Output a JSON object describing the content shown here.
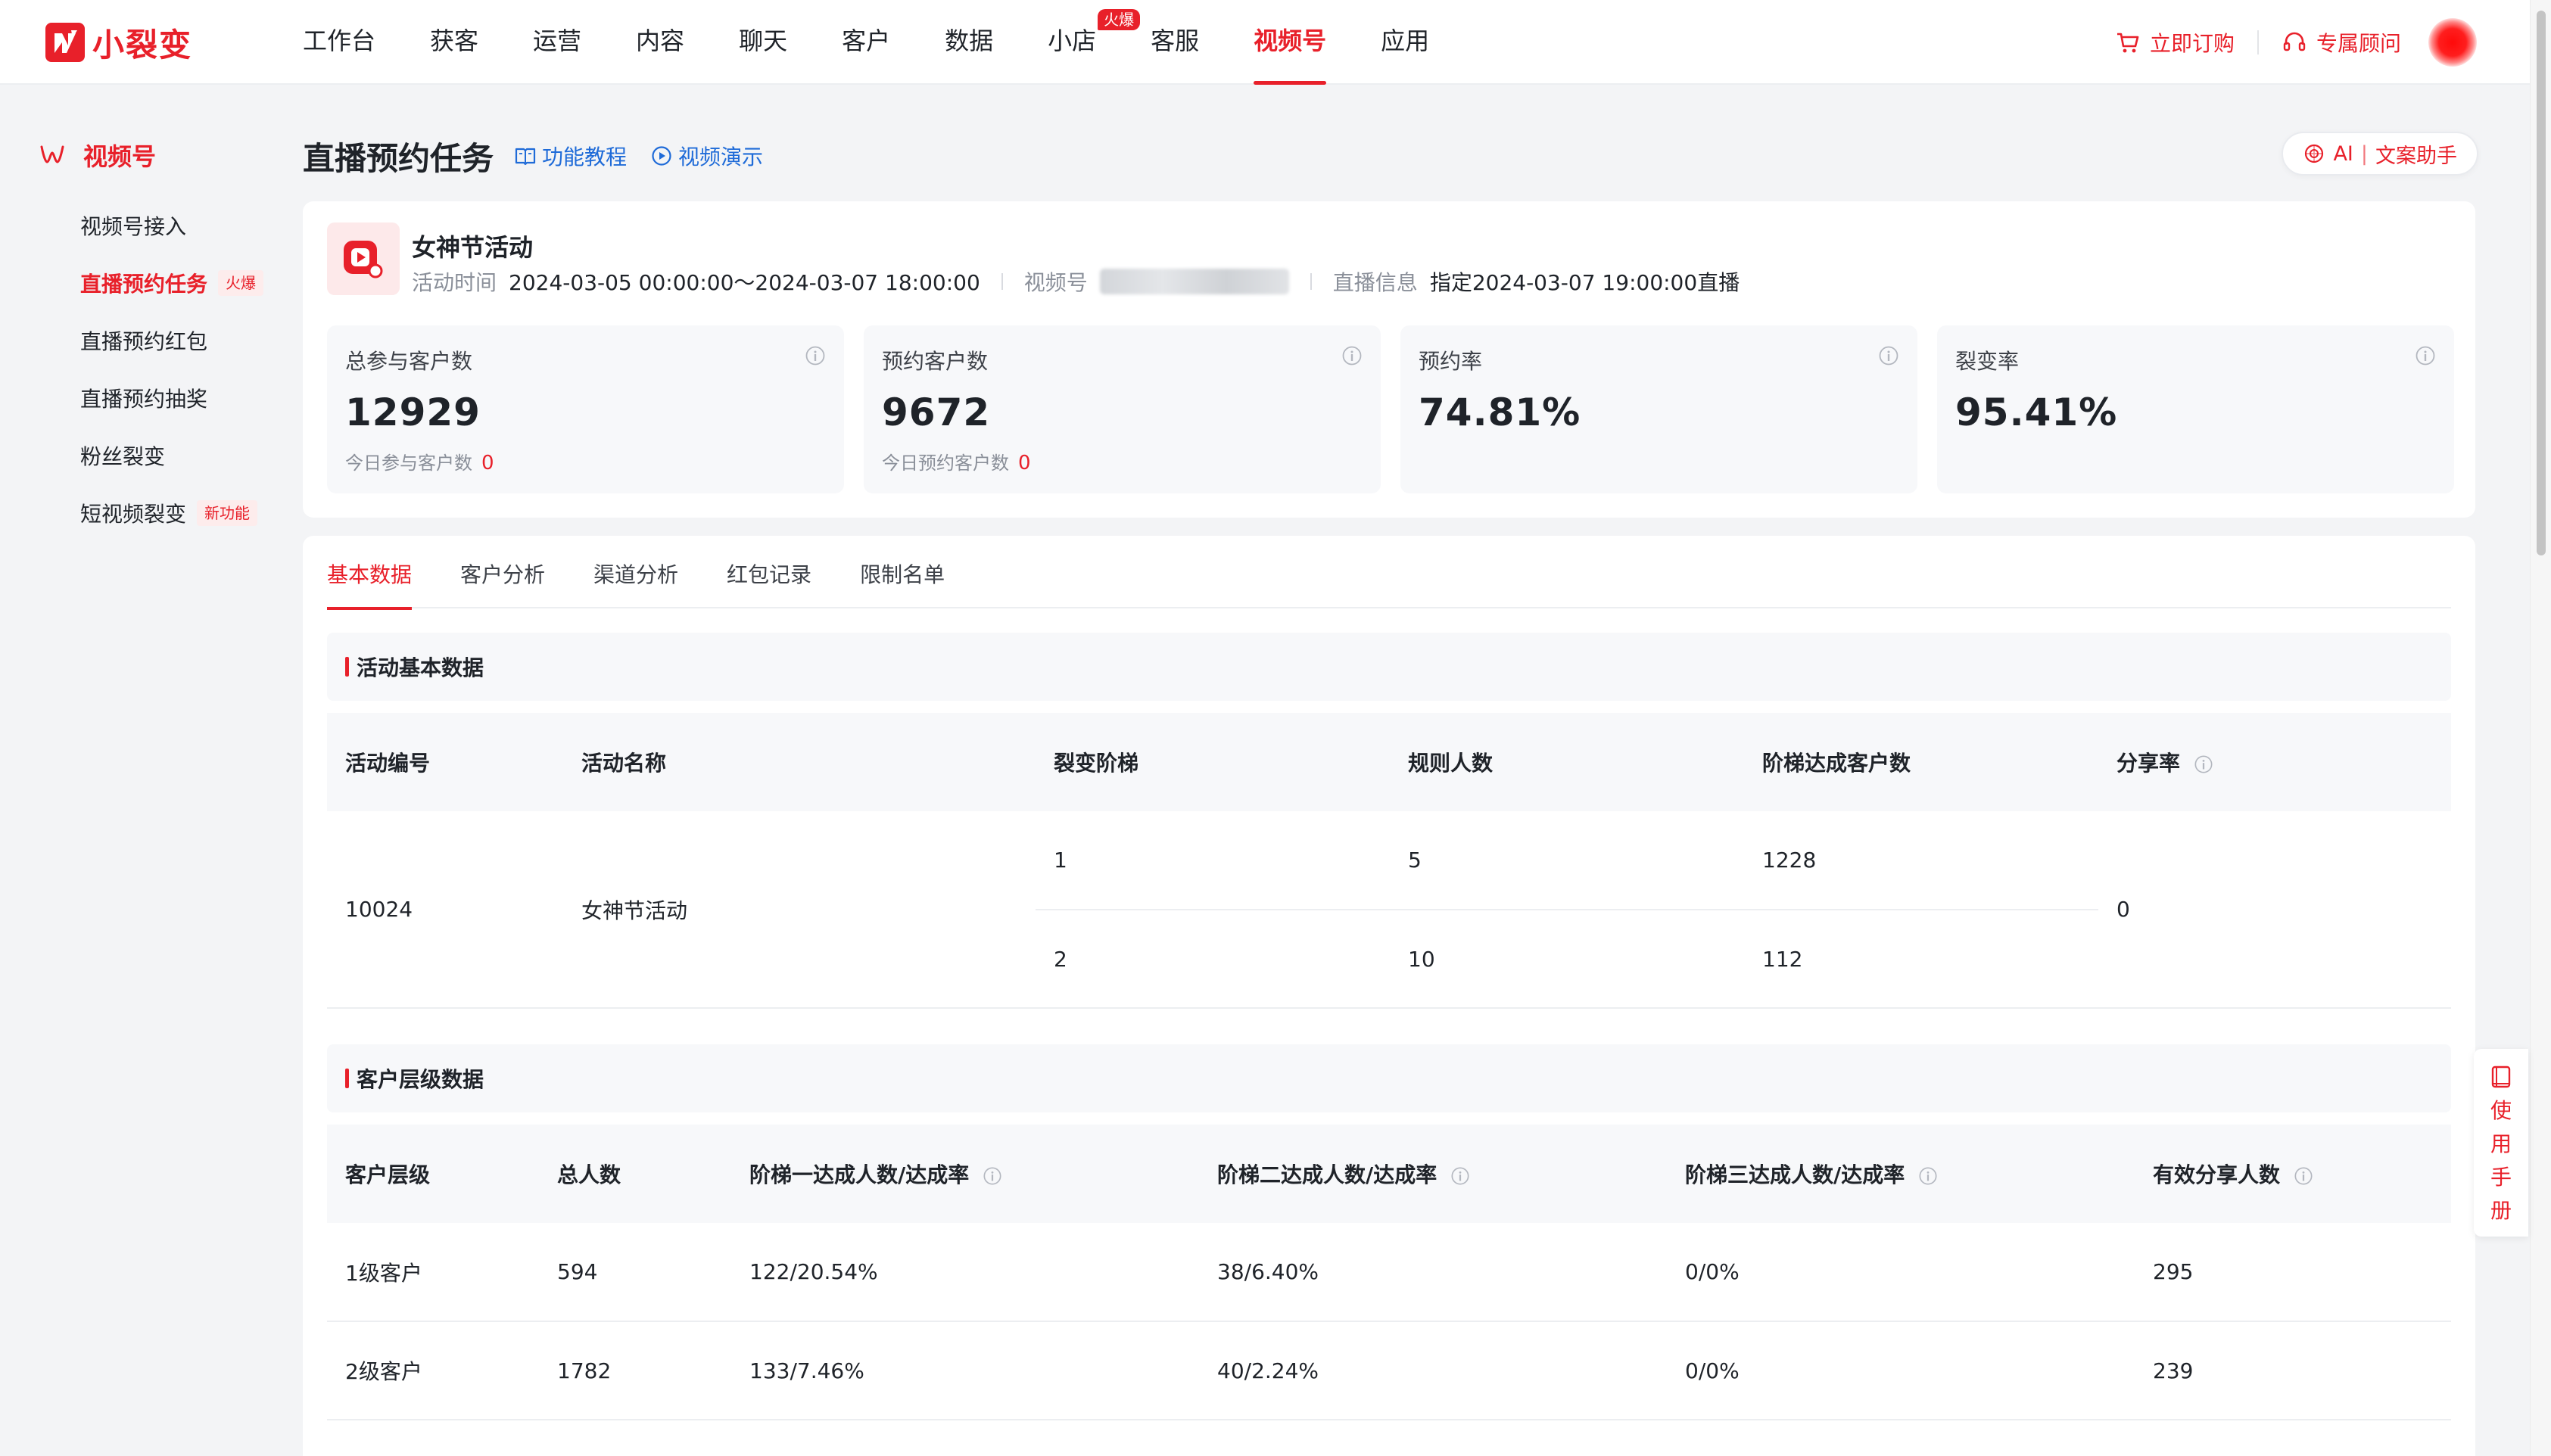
{
  "app": {
    "brand": "小裂变",
    "accent_color": "#e8202a"
  },
  "nav": {
    "items": [
      {
        "label": "工作台"
      },
      {
        "label": "获客"
      },
      {
        "label": "运营"
      },
      {
        "label": "内容"
      },
      {
        "label": "聊天"
      },
      {
        "label": "客户"
      },
      {
        "label": "数据"
      },
      {
        "label": "小店",
        "badge": "火爆"
      },
      {
        "label": "客服"
      },
      {
        "label": "视频号",
        "active": true
      },
      {
        "label": "应用"
      }
    ],
    "shop_badge": "火爆",
    "order_label": "立即订购",
    "advisor_label": "专属顾问",
    "order_icon": "cart-icon",
    "advisor_icon": "headset-icon"
  },
  "sidebar": {
    "title": "视频号",
    "items": [
      {
        "label": "视频号接入"
      },
      {
        "label": "直播预约任务",
        "tag": "火爆",
        "active": true
      },
      {
        "label": "直播预约红包"
      },
      {
        "label": "直播预约抽奖"
      },
      {
        "label": "粉丝裂变"
      },
      {
        "label": "短视频裂变",
        "tag": "新功能"
      }
    ]
  },
  "page": {
    "title": "直播预约任务",
    "tutorial_link": "功能教程",
    "video_link": "视频演示",
    "ai_label": "AI",
    "ai_sub": "文案助手"
  },
  "activity": {
    "name": "女神节活动",
    "time_label": "活动时间",
    "time_value": "2024-03-05 00:00:00～2024-03-07 18:00:00",
    "channel_label": "视频号",
    "live_label": "直播信息",
    "live_value": "指定2024-03-07 19:00:00直播"
  },
  "stats": [
    {
      "label": "总参与客户数",
      "value": "12929",
      "sub_label": "今日参与客户数",
      "sub_value": "0"
    },
    {
      "label": "预约客户数",
      "value": "9672",
      "sub_label": "今日预约客户数",
      "sub_value": "0"
    },
    {
      "label": "预约率",
      "value": "74.81%"
    },
    {
      "label": "裂变率",
      "value": "95.41%"
    }
  ],
  "tabs": [
    {
      "label": "基本数据",
      "active": true
    },
    {
      "label": "客户分析"
    },
    {
      "label": "渠道分析"
    },
    {
      "label": "红包记录"
    },
    {
      "label": "限制名单"
    }
  ],
  "basic_section": {
    "title": "活动基本数据",
    "columns": [
      "活动编号",
      "活动名称",
      "裂变阶梯",
      "规则人数",
      "阶梯达成客户数",
      "分享率"
    ],
    "row": {
      "id": "10024",
      "name": "女神节活动",
      "stairs": [
        {
          "level": "1",
          "rule": "5",
          "reached": "1228"
        },
        {
          "level": "2",
          "rule": "10",
          "reached": "112"
        }
      ],
      "share_rate": "0"
    }
  },
  "level_section": {
    "title": "客户层级数据",
    "columns": [
      "客户层级",
      "总人数",
      "阶梯一达成人数/达成率",
      "阶梯二达成人数/达成率",
      "阶梯三达成人数/达成率",
      "有效分享人数"
    ],
    "rows": [
      [
        "1级客户",
        "594",
        "122/20.54%",
        "38/6.40%",
        "0/0%",
        "295"
      ],
      [
        "2级客户",
        "1782",
        "133/7.46%",
        "40/2.24%",
        "0/0%",
        "239"
      ]
    ]
  },
  "manual": {
    "label": "使用手册"
  }
}
